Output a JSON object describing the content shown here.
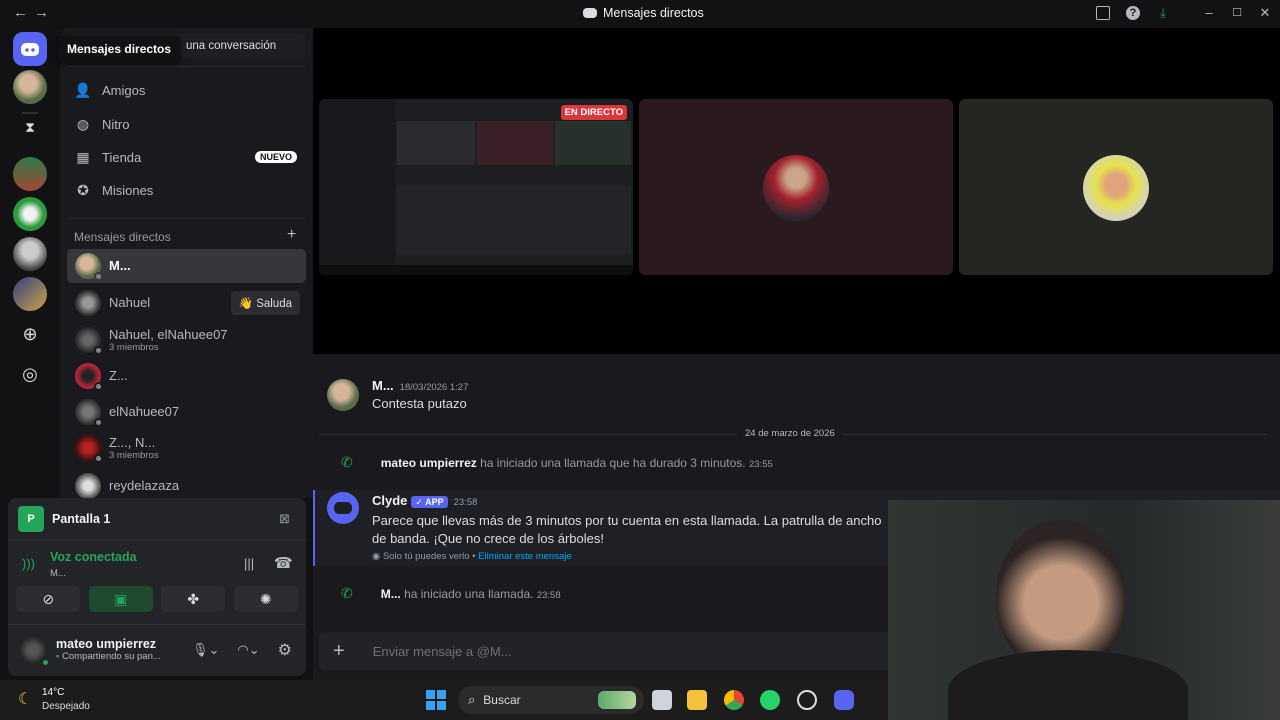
{
  "window": {
    "title": "Mensajes directos",
    "tooltip": "Mensajes directos"
  },
  "search": {
    "placeholder": "una conversación"
  },
  "nav": {
    "friends": "Amigos",
    "nitro": "Nitro",
    "shop": "Tienda",
    "shop_badge": "NUEVO",
    "quests": "Misiones"
  },
  "dm_section": {
    "header": "Mensajes directos"
  },
  "dms": [
    {
      "name": "M...",
      "sub": ""
    },
    {
      "name": "Nahuel",
      "sub": "",
      "action": "Saluda"
    },
    {
      "name": "Nahuel, elNahuee07",
      "sub": "3 miembros"
    },
    {
      "name": "Z...",
      "sub": ""
    },
    {
      "name": "elNahuee07",
      "sub": ""
    },
    {
      "name": "Z..., N...",
      "sub": "3 miembros"
    },
    {
      "name": "reydelazaza",
      "sub": ""
    }
  ],
  "stream_panel": {
    "label": "Pantalla 1",
    "badge": "P"
  },
  "voice": {
    "status": "Voz conectada",
    "channel": "M..."
  },
  "user": {
    "name": "mateo umpierrez",
    "status": "Compartiendo su pan..."
  },
  "call": {
    "live_label": "EN DIRECTO"
  },
  "messages": {
    "m1_author": "M...",
    "m1_time": "18/03/2026 1:27",
    "m1_text": "Contesta putazo",
    "day_divider": "24 de marzo de 2026",
    "call1_author": "mateo umpierrez",
    "call1_text": "ha iniciado una llamada que ha durado 3 minutos.",
    "call1_time": "23:55",
    "clyde_author": "Clyde",
    "clyde_badge": "APP",
    "clyde_time": "23:58",
    "clyde_text": "Parece que llevas más de 3 minutos por tu cuenta en esta llamada. La patrulla de ancho de banda. ¡Que no crece de los árboles!",
    "clyde_note": "Solo tú puedes verlo •",
    "clyde_note_link": "Eliminar este mensaje",
    "call2_author": "M...",
    "call2_text": "ha iniciado una llamada.",
    "call2_time": "23:58"
  },
  "composer": {
    "placeholder": "Enviar mensaje a @M..."
  },
  "taskbar": {
    "temp": "14°C",
    "weather": "Despejado",
    "search": "Buscar"
  },
  "colors": {
    "blurple": "#5865f2",
    "green": "#23a55a",
    "live_red": "#da373c"
  }
}
